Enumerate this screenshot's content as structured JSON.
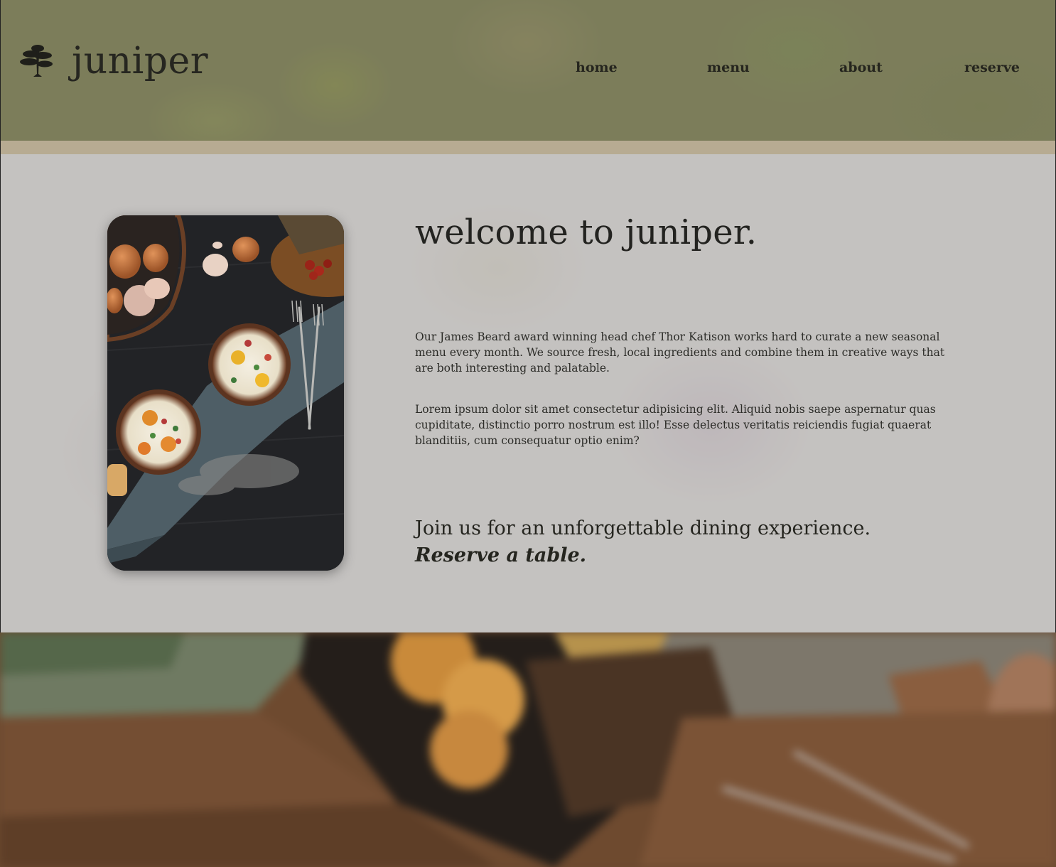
{
  "brand": {
    "name": "juniper",
    "logo_icon": "bonsai-tree-icon"
  },
  "nav": {
    "items": [
      "home",
      "menu",
      "about",
      "reserve"
    ]
  },
  "main": {
    "headline": "welcome to juniper.",
    "paragraphs": [
      "Our James Beard award winning head chef Thor Katison works hard to curate a new seasonal menu every month. We source fresh, local ingredients and combine them in creative ways that are both interesting and palatable.",
      "Lorem ipsum dolor sit amet consectetur adipisicing elit. Aliquid nobis saepe aspernatur quas cupiditate, distinctio porro nostrum est illo! Esse delectus veritatis reiciendis fugiat quaerat blanditiis, cum consequatur optio enim?"
    ],
    "cta_text": "Join us for an unforgettable dining experience.",
    "cta_link": "Reserve a table."
  },
  "colors": {
    "header_bg": "#7d805c",
    "strip": "#b7ab92",
    "main_bg": "#c8c6c4",
    "text_dark": "#232320"
  }
}
